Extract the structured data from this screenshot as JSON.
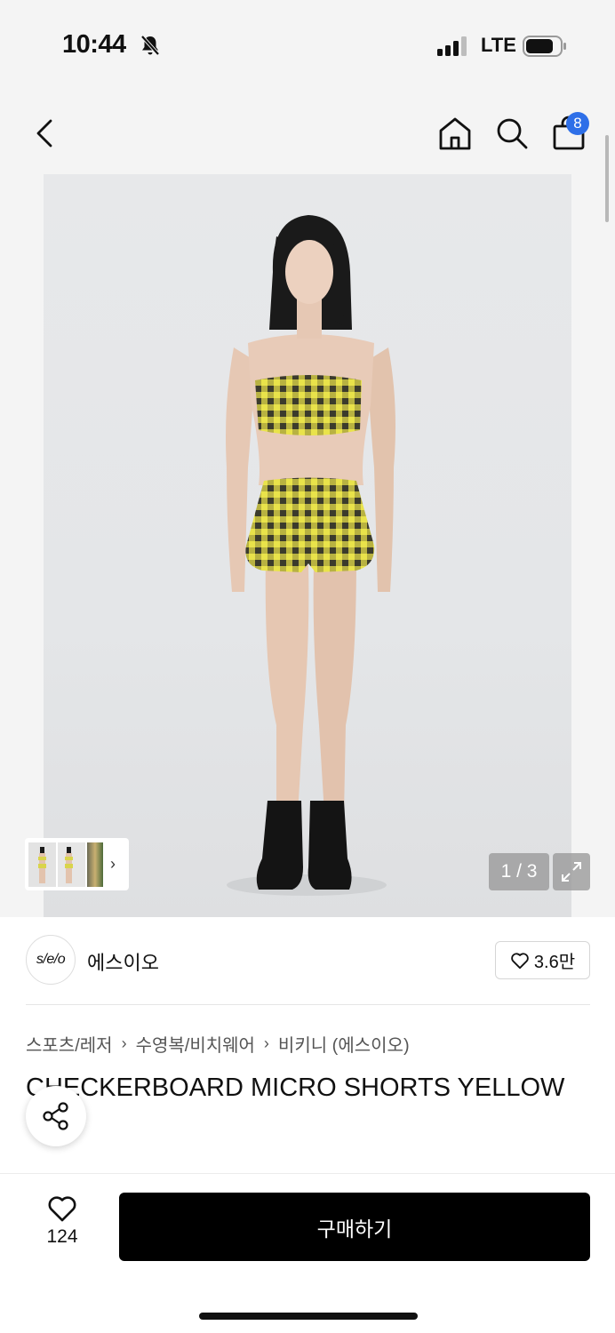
{
  "status": {
    "time": "10:44",
    "network": "LTE"
  },
  "cart": {
    "count": "8"
  },
  "gallery": {
    "page_indicator": "1 / 3"
  },
  "brand": {
    "logo_text": "s/e/o",
    "name": "에스이오",
    "likes": "3.6만"
  },
  "breadcrumbs": [
    "스포츠/레저",
    "수영복/비치웨어",
    "비키니 (에스이오)"
  ],
  "product": {
    "title": "CHECKERBOARD MICRO SHORTS YELLOW"
  },
  "actions": {
    "wish_count": "124",
    "buy_label": "구매하기"
  },
  "colors": {
    "accent": "#2e6fe8",
    "buy_button": "#000000",
    "check_yellow": "#e9e34a",
    "check_dark": "#3b3b2c"
  }
}
